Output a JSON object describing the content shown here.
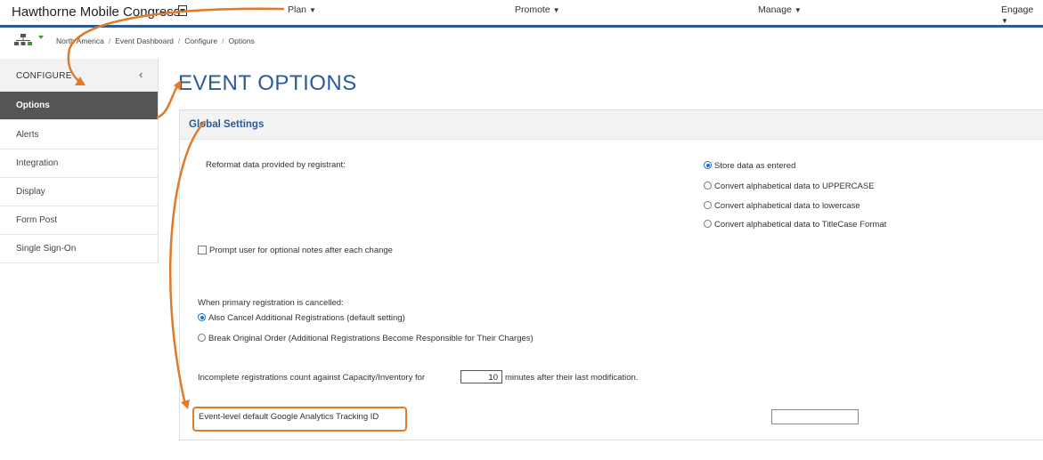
{
  "header": {
    "app_title": "Hawthorne Mobile Congress",
    "nav": [
      {
        "label": "Plan"
      },
      {
        "label": "Promote"
      },
      {
        "label": "Manage"
      },
      {
        "label": "Engage"
      }
    ]
  },
  "breadcrumb": [
    "North America",
    "Event Dashboard",
    "Configure",
    "Options"
  ],
  "sidebar": {
    "title": "CONFIGURE",
    "items": [
      {
        "label": "Options",
        "active": true
      },
      {
        "label": "Alerts"
      },
      {
        "label": "Integration"
      },
      {
        "label": "Display"
      },
      {
        "label": "Form Post"
      },
      {
        "label": "Single Sign-On"
      }
    ]
  },
  "main": {
    "page_title": "EVENT OPTIONS",
    "panel_title": "Global Settings",
    "reformat_label": "Reformat data provided by registrant:",
    "reformat_options": [
      {
        "label": "Store data as entered",
        "selected": true
      },
      {
        "label": "Convert alphabetical data to UPPERCASE"
      },
      {
        "label": "Convert alphabetical data to lowercase"
      },
      {
        "label": "Convert alphabetical data to TitleCase Format"
      }
    ],
    "prompt_notes_label": "Prompt user for optional notes after each change",
    "cancel_label": "When primary registration is cancelled:",
    "cancel_options": [
      {
        "label": "Also Cancel Additional Registrations (default setting)",
        "selected": true
      },
      {
        "label": "Break Original Order (Additional Registrations Become Responsible for Their Charges)"
      }
    ],
    "incomplete_prefix": "Incomplete registrations count against Capacity/Inventory for",
    "incomplete_minutes": "10",
    "incomplete_suffix": "minutes after their last modification.",
    "ga_label": "Event-level default Google Analytics Tracking ID",
    "ga_value": ""
  },
  "annotation_color": "#e07b2c"
}
